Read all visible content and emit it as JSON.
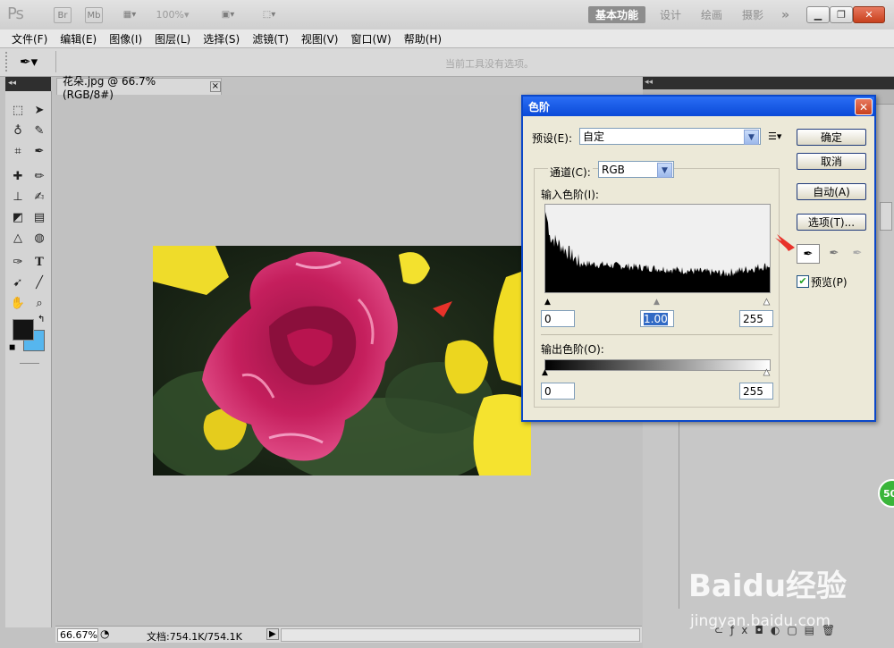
{
  "app": {
    "logo": "Ps",
    "zoom": "100%",
    "workspaces": [
      "基本功能",
      "设计",
      "绘画",
      "摄影"
    ],
    "more_symbol": "»"
  },
  "menu": [
    "文件(F)",
    "编辑(E)",
    "图像(I)",
    "图层(L)",
    "选择(S)",
    "滤镜(T)",
    "视图(V)",
    "窗口(W)",
    "帮助(H)"
  ],
  "options_bar": {
    "hint": "当前工具没有选项。"
  },
  "document": {
    "tab_title": "花朵.jpg @ 66.7%(RGB/8#)",
    "close_symbol": "×"
  },
  "status": {
    "zoom": "66.67%",
    "doc_size": "文档:754.1K/754.1K"
  },
  "levels_dialog": {
    "title": "色阶",
    "preset_label": "预设(E):",
    "preset_value": "自定",
    "channel_label": "通道(C):",
    "channel_value": "RGB",
    "input_label": "输入色阶(I):",
    "input_black": "0",
    "input_gamma": "1.00",
    "input_white": "255",
    "output_label": "输出色阶(O):",
    "output_black": "0",
    "output_white": "255",
    "buttons": {
      "ok": "确定",
      "cancel": "取消",
      "auto": "自动(A)",
      "options": "选项(T)..."
    },
    "preview_label": "预览(P)",
    "preview_checked": true
  },
  "watermark": {
    "brand": "Baidu经验",
    "url": "jingyan.baidu.com"
  },
  "side_badge": "50",
  "colors": {
    "title_blue": "#0b4ad8",
    "close_red": "#d9532c",
    "accent_red_arrow": "#e8322a"
  }
}
